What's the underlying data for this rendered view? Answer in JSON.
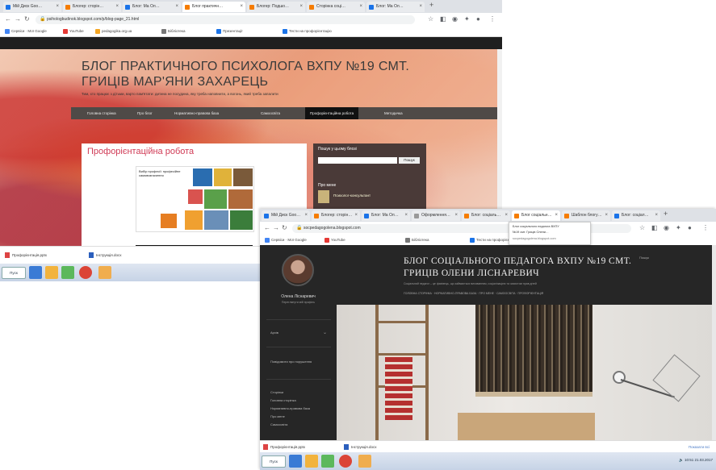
{
  "window1": {
    "tabs": [
      {
        "label": "Мій Диск Goo…"
      },
      {
        "label": "Блогер: сторін…"
      },
      {
        "label": "Блог: Ма Ол…"
      },
      {
        "label": "Блог практичн…"
      },
      {
        "label": "Блогер: Подшо…"
      },
      {
        "label": "Сторінка соці…"
      },
      {
        "label": "Блог: Ма Ол…"
      }
    ],
    "url": "psihologbudinok.blogspot.com/p/blog-page_21.html",
    "bookmarks": [
      "Сервіси · Мої Google",
      "YouTube",
      "pedagogika.org.ua",
      "Бібліотека",
      "Презентації",
      "Тести на профорієнтацію"
    ],
    "blog": {
      "title": "БЛОГ ПРАКТИЧНОГО ПСИХОЛОГА ВХПУ №19 СМТ. ГРИЦІВ МАР'ЯНИ ЗАХАРЕЦЬ",
      "description": "Тим, хто працює з дітьми, варто пам'ятати: дитина не посудина, яку треба наповнити, а вогонь, який треба запалити",
      "menu": [
        "Головна сторінка",
        "Про блог",
        "Нормативно-правова база",
        "Самоосвіта",
        "Профорієнтаційна робота",
        "Методичка"
      ],
      "active_menu_index": 4,
      "post_title": "Профорієнтаційна робота",
      "poster_text": "Вибір професії: професійне самовизначення",
      "sidebar_title": "Пошук у цьому блозі",
      "search_button": "Пошук",
      "sidebar_sub": "Про мене",
      "sidebar_link": "Психолог-консультант"
    },
    "downloads": [
      "Профорієнтація.pptx",
      "Інструкція.docx"
    ],
    "start_label": "Пуск"
  },
  "window2": {
    "tabs": [
      {
        "label": "Мій Диск Goo…"
      },
      {
        "label": "Блогер: сторін…"
      },
      {
        "label": "Блог: Ма Ол…"
      },
      {
        "label": "Оформлення…"
      },
      {
        "label": "Блог: соціаль…"
      },
      {
        "label": "Блог соціальн…"
      },
      {
        "label": "Шаблон блогу…"
      },
      {
        "label": "Блог: соціал…"
      }
    ],
    "url": "socpedagogolena.blogspot.com",
    "bookmarks": [
      "Сервіси · Мої Google",
      "YouTube",
      "Бібліотека",
      "Тести на профорієнтацію"
    ],
    "popup": [
      "Блог соціального педагога ВХПУ",
      "№19 смт. Гриців Олени…",
      "socpedagogolena.blogspot.com"
    ],
    "author_name": "Олена Ліснаревич",
    "author_sub": "Переглянути мій профіль",
    "sidebar_items": [
      "Архів",
      "Повідомити про порушення",
      "Сторінки",
      "Головна сторінка",
      "Нормативно-правова база",
      "Про мене",
      "Самоосвіта"
    ],
    "blog_title": "БЛОГ СОЦІАЛЬНОГО ПЕДАГОГА ВХПУ №19 СМТ. ГРИЦІВ ОЛЕНИ ЛІСНАРЕВИЧ",
    "blog_desc": "Соціальний педагог – це фахівець, що займається вихованням, соціалізацією та захистом прав дітей",
    "blog_nav": "ГОЛОВНА СТОРІНКА · НОРМАТИВНО-ПРАВОВА БАЗА · ПРО МЕНЕ · САМООСВІТА · ПРОФОРІЄНТАЦІЯ",
    "search_label": "Пошук",
    "downloads": [
      "Профорієнтація.pptx",
      "Інструкція.docx"
    ],
    "show_all": "Показати всі",
    "tray_time": "10:51",
    "tray_date": "21.03.2017",
    "start_label": "Пуск"
  },
  "colors": {
    "accent_pink": "#d03a55",
    "tab_strip": "#dee1e6",
    "blog2_dark": "#262626",
    "menu_dark": "#4f4a47"
  }
}
